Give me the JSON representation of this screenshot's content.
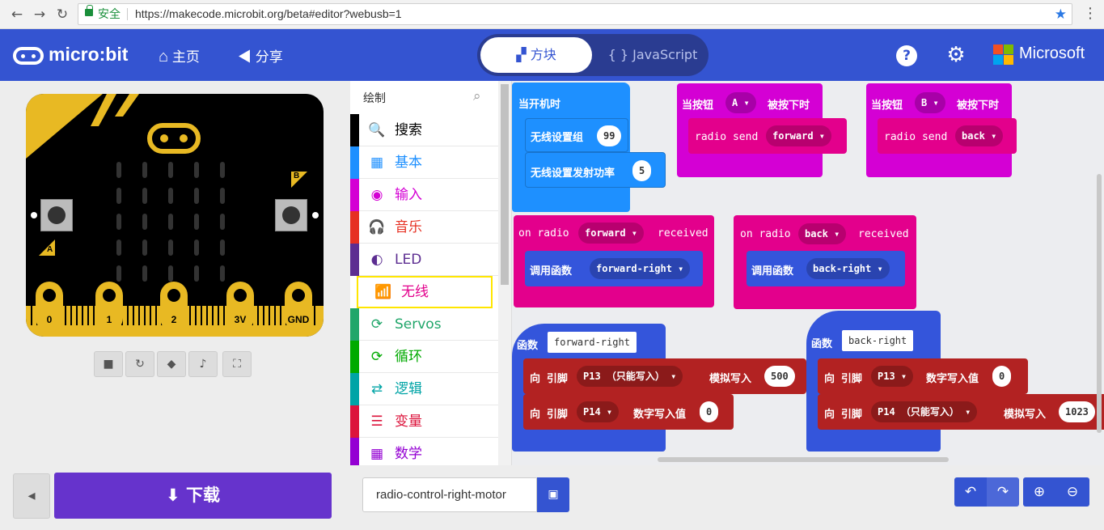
{
  "browser": {
    "secure_label": "安全",
    "url": "https://makecode.microbit.org/beta#editor?webusb=1"
  },
  "header": {
    "logo_text": "micro:bit",
    "home_label": "主页",
    "share_label": "分享",
    "blocks_tab": "方块",
    "js_tab": "{ } JavaScript",
    "brand": "Microsoft"
  },
  "simulator": {
    "pins": [
      "0",
      "1",
      "2",
      "3V",
      "GND"
    ],
    "button_a": "A",
    "button_b": "B"
  },
  "toolbox": {
    "header": "绘制",
    "categories": [
      {
        "label": "搜索",
        "color": "#000000"
      },
      {
        "label": "基本",
        "color": "#1e90ff"
      },
      {
        "label": "输入",
        "color": "#d400d4"
      },
      {
        "label": "音乐",
        "color": "#e63022"
      },
      {
        "label": "LED",
        "color": "#5c2d91"
      },
      {
        "label": "无线",
        "color": "#e3008c"
      },
      {
        "label": "Servos",
        "color": "#20a66a"
      },
      {
        "label": "循环",
        "color": "#00aa00"
      },
      {
        "label": "逻辑",
        "color": "#00a4a6"
      },
      {
        "label": "变量",
        "color": "#dc143c"
      },
      {
        "label": "数学",
        "color": "#9400d3"
      }
    ]
  },
  "workspace": {
    "on_start": {
      "title": "当开机时",
      "set_group": "无线设置组",
      "group_value": "99",
      "set_power": "无线设置发射功率",
      "power_value": "5"
    },
    "btn_a": {
      "prefix": "当按钮",
      "button": "A",
      "suffix": "被按下时",
      "send": "radio send",
      "value": "forward"
    },
    "btn_b": {
      "prefix": "当按钮",
      "button": "B",
      "suffix": "被按下时",
      "send": "radio send",
      "value": "back"
    },
    "radio_fwd": {
      "on": "on radio",
      "value": "forward",
      "received": "received",
      "call": "调用函数",
      "func": "forward-right"
    },
    "radio_back": {
      "on": "on radio",
      "value": "back",
      "received": "received",
      "call": "调用函数",
      "func": "back-right"
    },
    "func_fwd": {
      "title": "函数",
      "name": "forward-right",
      "line1": {
        "to": "向 引脚",
        "pin": "P13 （只能写入）",
        "op": "模拟写入",
        "value": "500"
      },
      "line2": {
        "to": "向 引脚",
        "pin": "P14",
        "op": "数字写入值",
        "value": "0"
      }
    },
    "func_back": {
      "title": "函数",
      "name": "back-right",
      "line1": {
        "to": "向 引脚",
        "pin": "P13",
        "op": "数字写入值",
        "value": "0"
      },
      "line2": {
        "to": "向 引脚",
        "pin": "P14 （只能写入）",
        "op": "模拟写入",
        "value": "1023"
      }
    }
  },
  "footer": {
    "download": "下载",
    "project_name": "radio-control-right-motor"
  },
  "colors": {
    "header": "#3454d1",
    "basic": "#1e90ff",
    "input": "#d400d4",
    "radio": "#e3008c",
    "functions": "#3455db",
    "pins": "#b22222",
    "download": "#6633cc"
  }
}
